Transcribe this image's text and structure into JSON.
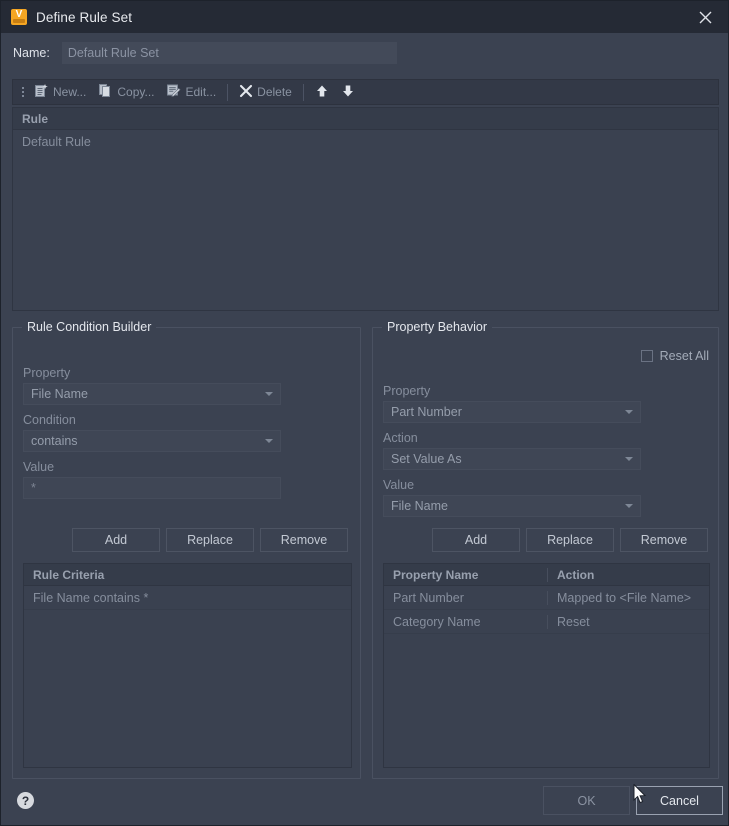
{
  "window": {
    "title": "Define Rule Set",
    "app_icon": "vault-app-icon",
    "close_icon": "close-icon"
  },
  "name_field": {
    "label": "Name:",
    "value": "Default Rule Set",
    "placeholder": "Default Rule Set"
  },
  "toolbar": {
    "grip": "drag-grip",
    "items": [
      {
        "label": "New...",
        "icon": "new-document-icon"
      },
      {
        "label": "Copy...",
        "icon": "copy-icon"
      },
      {
        "label": "Edit...",
        "icon": "edit-pencil-icon"
      },
      {
        "label": "Delete",
        "icon": "delete-x-icon"
      }
    ],
    "move_up": "arrow-up-icon",
    "move_down": "arrow-down-icon"
  },
  "rule_list": {
    "header": "Rule",
    "rows": [
      "Default Rule"
    ]
  },
  "condition_builder": {
    "title": "Rule Condition Builder",
    "property_label": "Property",
    "property_value": "File Name",
    "condition_label": "Condition",
    "condition_value": "contains",
    "value_label": "Value",
    "value_value": "*",
    "buttons": {
      "add": "Add",
      "replace": "Replace",
      "remove": "Remove"
    },
    "criteria_table": {
      "header": "Rule Criteria",
      "rows": [
        "File Name contains *"
      ]
    }
  },
  "property_behavior": {
    "title": "Property Behavior",
    "reset_all_label": "Reset All",
    "reset_all_checked": false,
    "property_label": "Property",
    "property_value": "Part Number",
    "action_label": "Action",
    "action_value": "Set Value As",
    "value_label": "Value",
    "value_value": "File Name",
    "buttons": {
      "add": "Add",
      "replace": "Replace",
      "remove": "Remove"
    },
    "behavior_table": {
      "headers": [
        "Property Name",
        "Action"
      ],
      "rows": [
        {
          "property": "Part Number",
          "action": "Mapped to <File Name>"
        },
        {
          "property": "Category Name",
          "action": "Reset"
        }
      ]
    }
  },
  "footer": {
    "help_icon": "help-question-icon",
    "help_glyph": "?",
    "ok_label": "OK",
    "cancel_label": "Cancel"
  },
  "colors": {
    "dialog_background": "#3b4251",
    "titlebar_background": "#252a35",
    "list_background": "#3a4150",
    "table_header_background": "#353c4a",
    "accent_icon": "#f5a623",
    "text_primary": "#e4e7ed",
    "text_muted": "#868e9d"
  }
}
